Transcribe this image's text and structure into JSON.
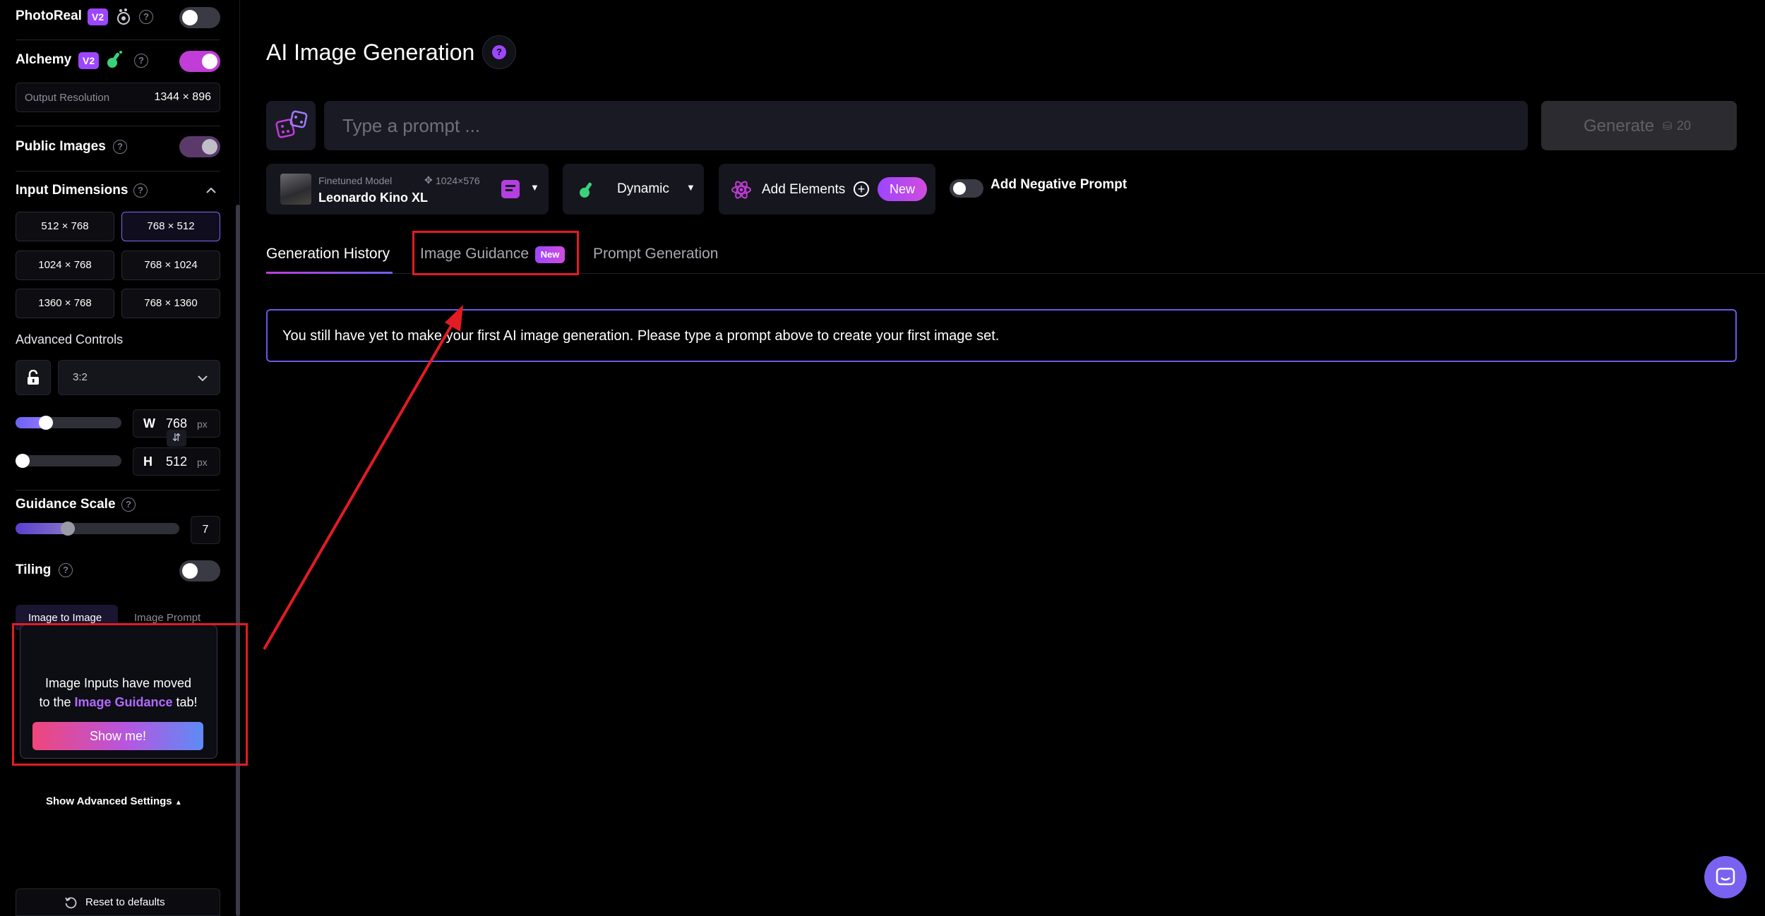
{
  "sidebar": {
    "photoreal": {
      "label": "PhotoReal",
      "badge": "V2",
      "help": "?"
    },
    "alchemy": {
      "label": "Alchemy",
      "badge": "V2",
      "help": "?"
    },
    "output_resolution": {
      "label": "Output Resolution",
      "value": "1344 × 896"
    },
    "public_images": {
      "label": "Public Images",
      "help": "?"
    },
    "input_dimensions": {
      "label": "Input Dimensions",
      "help": "?",
      "options": [
        "512 × 768",
        "768 × 512",
        "1024 × 768",
        "768 × 1024",
        "1360 × 768",
        "768 × 1360"
      ],
      "selected": "768 × 512"
    },
    "advanced_controls": {
      "label": "Advanced Controls",
      "aspect_ratio": "3:2"
    },
    "width": {
      "letter": "W",
      "value": "768",
      "unit": "px",
      "level": 0.25
    },
    "height": {
      "letter": "H",
      "value": "512",
      "unit": "px",
      "level": 0.0
    },
    "guidance_scale": {
      "label": "Guidance Scale",
      "help": "?",
      "value": "7",
      "level": 0.3
    },
    "tiling": {
      "label": "Tiling",
      "help": "?"
    },
    "image_tabs": [
      "Image to Image",
      "Image Prompt"
    ],
    "image_notice": {
      "line1": "Image Inputs have moved",
      "line2_prefix": "to the ",
      "line2_link": "Image Guidance",
      "line2_suffix": " tab!",
      "button": "Show me!"
    },
    "show_advanced": "Show Advanced Settings",
    "reset": "Reset to defaults"
  },
  "main": {
    "title": "AI Image Generation",
    "help": "?",
    "prompt_placeholder": "Type a prompt ...",
    "generate": {
      "label": "Generate",
      "cost": "20"
    },
    "model": {
      "caption": "Finetuned Model",
      "size": "1024×576",
      "name": "Leonardo Kino XL"
    },
    "style": "Dynamic",
    "elements": {
      "label": "Add Elements",
      "badge": "New"
    },
    "negative_prompt": "Add Negative Prompt",
    "tabs": [
      {
        "label": "Generation History",
        "active": true
      },
      {
        "label": "Image Guidance",
        "badge": "New"
      },
      {
        "label": "Prompt Generation"
      }
    ],
    "empty_message": "You still have yet to make your first AI image generation. Please type a prompt above to create your first image set."
  },
  "colors": {
    "accent": "#9d46ff",
    "annotation": "#e31b23",
    "toggle_on": "#c13dd8"
  }
}
